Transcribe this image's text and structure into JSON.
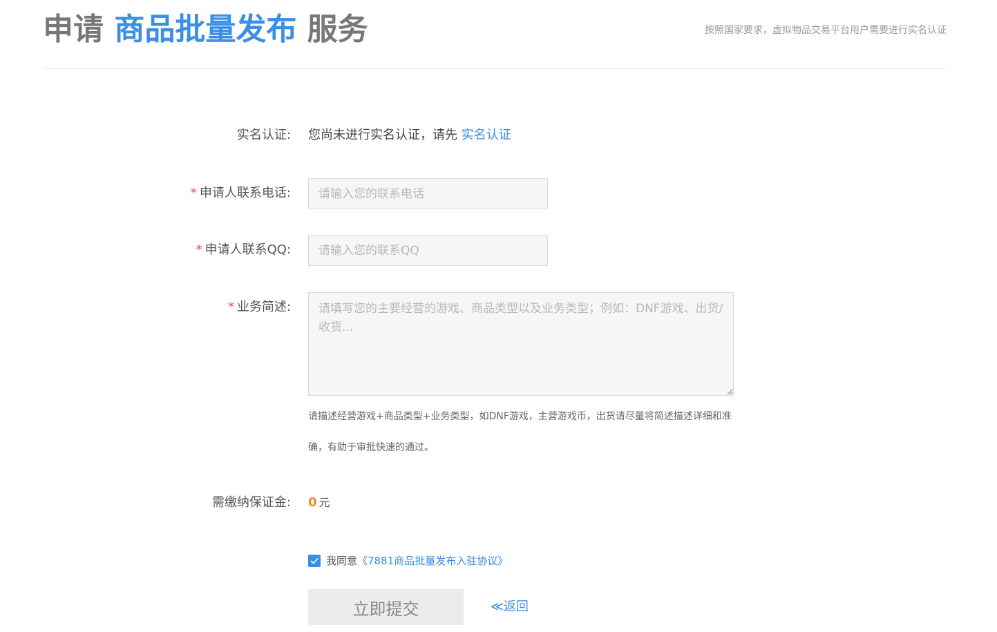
{
  "header": {
    "title_prefix": "申请",
    "title_highlight": "商品批量发布",
    "title_suffix": "服务",
    "notice": "按照国家要求，虚拟物品交易平台用户需要进行实名认证"
  },
  "form": {
    "realname": {
      "label": "实名认证:",
      "text": "您尚未进行实名认证，请先",
      "link": "实名认证"
    },
    "phone": {
      "required_mark": "*",
      "label": "申请人联系电话:",
      "value": "",
      "placeholder": "请输入您的联系电话"
    },
    "qq": {
      "required_mark": "*",
      "label": "申请人联系QQ:",
      "value": "",
      "placeholder": "请输入您的联系QQ"
    },
    "description": {
      "required_mark": "*",
      "label": "业务简述:",
      "value": "",
      "placeholder": "请填写您的主要经营的游戏、商品类型以及业务类型；例如：DNF游戏、出货/收货...",
      "hint": "请描述经营游戏+商品类型+业务类型，如DNF游戏，主营游戏币，出货请尽量将简述描述详细和准确，有助于审批快速的通过。"
    },
    "deposit": {
      "label": "需缴纳保证金:",
      "amount": "0",
      "unit": "元"
    },
    "agreement": {
      "checked": true,
      "text": "我同意",
      "link": "《7881商品批量发布入驻协议》"
    },
    "submit_label": "立即提交",
    "back_label": "≪返回"
  },
  "colors": {
    "accent": "#3a8ee6",
    "required": "#e34a4a",
    "amount": "#f08a24"
  }
}
